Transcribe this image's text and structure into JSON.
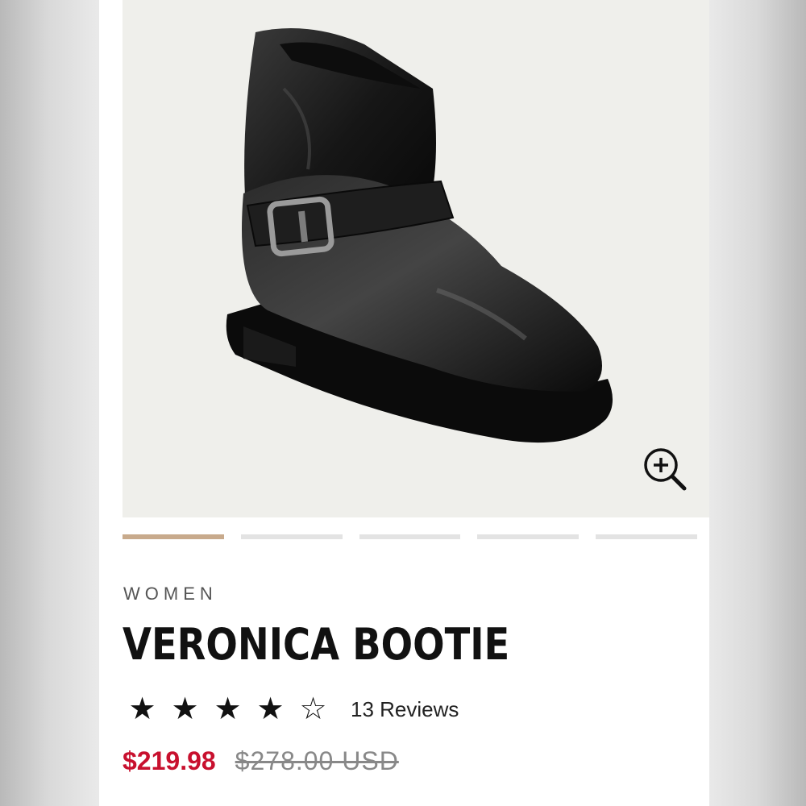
{
  "product": {
    "category": "WOMEN",
    "title": "VERONICA BOOTIE",
    "rating": 4,
    "rating_max": 5,
    "reviews_label": "13 Reviews",
    "sale_price": "$219.98",
    "original_price": "$278.00 USD"
  },
  "gallery": {
    "image_count": 5,
    "active_index": 0,
    "zoom_icon": "zoom-in-icon"
  },
  "colors": {
    "sale_price": "#c8102e",
    "active_indicator": "#c8aa8c",
    "inactive_indicator": "#e3e3e3"
  }
}
